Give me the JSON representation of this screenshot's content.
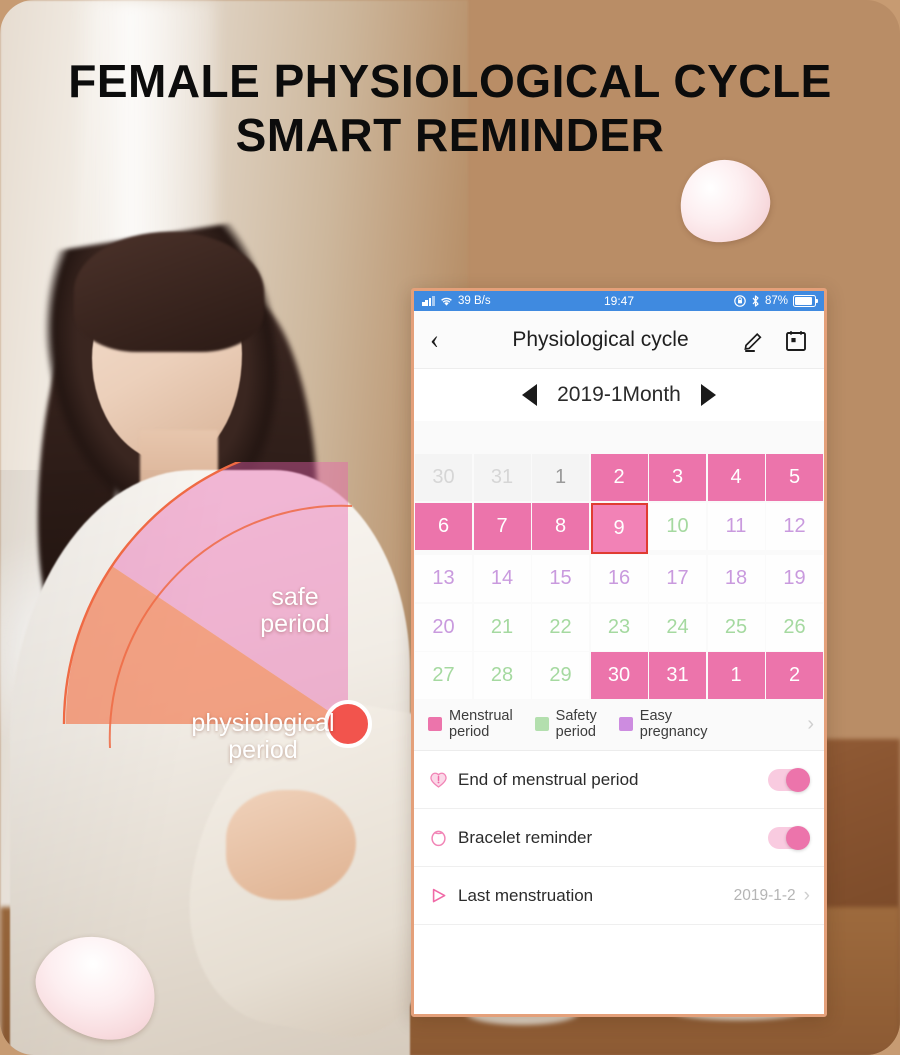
{
  "poster": {
    "headline_line1": "FEMALE PHYSIOLOGICAL CYCLE",
    "headline_line2": "SMART REMINDER"
  },
  "infographic": {
    "safe_label_line1": "safe",
    "safe_label_line2": "period",
    "physio_label_line1": "physiological",
    "physio_label_line2": "period",
    "colors": {
      "safe_sector": "#e98ac0",
      "physio_sector": "#f1825c",
      "ring_stroke": "#ef6a44",
      "dot": "#f2544d"
    }
  },
  "phone": {
    "status_bar": {
      "network_speed": "39 B/s",
      "time": "19:47",
      "battery_percent": "87%",
      "signal_icon": "signal-bars-icon",
      "wifi_icon": "wifi-icon",
      "rotation_lock_icon": "rotation-lock-icon",
      "bluetooth_icon": "bluetooth-icon",
      "battery_icon": "battery-icon",
      "background": "#3f8ae0"
    },
    "nav_bar": {
      "back_icon": "chevron-left-icon",
      "title": "Physiological cycle",
      "edit_icon": "pencil-edit-icon",
      "calendar_icon": "calendar-icon"
    },
    "month_selector": {
      "prev_icon": "triangle-left-icon",
      "label": "2019-1Month",
      "next_icon": "triangle-right-icon"
    },
    "calendar": {
      "selected_day": "9",
      "weeks": [
        [
          {
            "day": "30",
            "state": "muted"
          },
          {
            "day": "31",
            "state": "muted"
          },
          {
            "day": "1",
            "state": "muted cur"
          },
          {
            "day": "2",
            "state": "menstrual"
          },
          {
            "day": "3",
            "state": "menstrual"
          },
          {
            "day": "4",
            "state": "menstrual"
          },
          {
            "day": "5",
            "state": "menstrual"
          }
        ],
        [
          {
            "day": "6",
            "state": "menstrual"
          },
          {
            "day": "7",
            "state": "menstrual"
          },
          {
            "day": "8",
            "state": "menstrual"
          },
          {
            "day": "9",
            "state": "menstrual selected"
          },
          {
            "day": "10",
            "state": "safety"
          },
          {
            "day": "11",
            "state": "easy"
          },
          {
            "day": "12",
            "state": "easy"
          }
        ],
        [
          {
            "day": "13",
            "state": "easy"
          },
          {
            "day": "14",
            "state": "easy"
          },
          {
            "day": "15",
            "state": "easy"
          },
          {
            "day": "16",
            "state": "easy"
          },
          {
            "day": "17",
            "state": "easy"
          },
          {
            "day": "18",
            "state": "easy"
          },
          {
            "day": "19",
            "state": "easy"
          }
        ],
        [
          {
            "day": "20",
            "state": "easy"
          },
          {
            "day": "21",
            "state": "safety"
          },
          {
            "day": "22",
            "state": "safety"
          },
          {
            "day": "23",
            "state": "safety"
          },
          {
            "day": "24",
            "state": "safety"
          },
          {
            "day": "25",
            "state": "safety"
          },
          {
            "day": "26",
            "state": "safety"
          }
        ],
        [
          {
            "day": "27",
            "state": "safety"
          },
          {
            "day": "28",
            "state": "safety"
          },
          {
            "day": "29",
            "state": "safety"
          },
          {
            "day": "30",
            "state": "menstrual"
          },
          {
            "day": "31",
            "state": "menstrual"
          },
          {
            "day": "1",
            "state": "menstrual"
          },
          {
            "day": "2",
            "state": "menstrual"
          }
        ]
      ]
    },
    "legend": {
      "items": [
        {
          "label_line1": "Menstrual",
          "label_line2": "period",
          "color": "#ec74ab"
        },
        {
          "label_line1": "Safety",
          "label_line2": "period",
          "color": "#b3dfae"
        },
        {
          "label_line1": "Easy",
          "label_line2": "pregnancy",
          "color": "#cd8ce0"
        }
      ],
      "chevron_icon": "chevron-right-icon"
    },
    "settings": [
      {
        "icon": "heart-alert-icon",
        "label": "End of menstrual period",
        "control": "toggle",
        "toggle_on": true
      },
      {
        "icon": "bracelet-ring-icon",
        "label": "Bracelet reminder",
        "control": "toggle",
        "toggle_on": true
      },
      {
        "icon": "play-triangle-icon",
        "label": "Last menstruation",
        "control": "value",
        "value": "2019-1-2",
        "chevron_icon": "chevron-right-icon"
      }
    ]
  }
}
